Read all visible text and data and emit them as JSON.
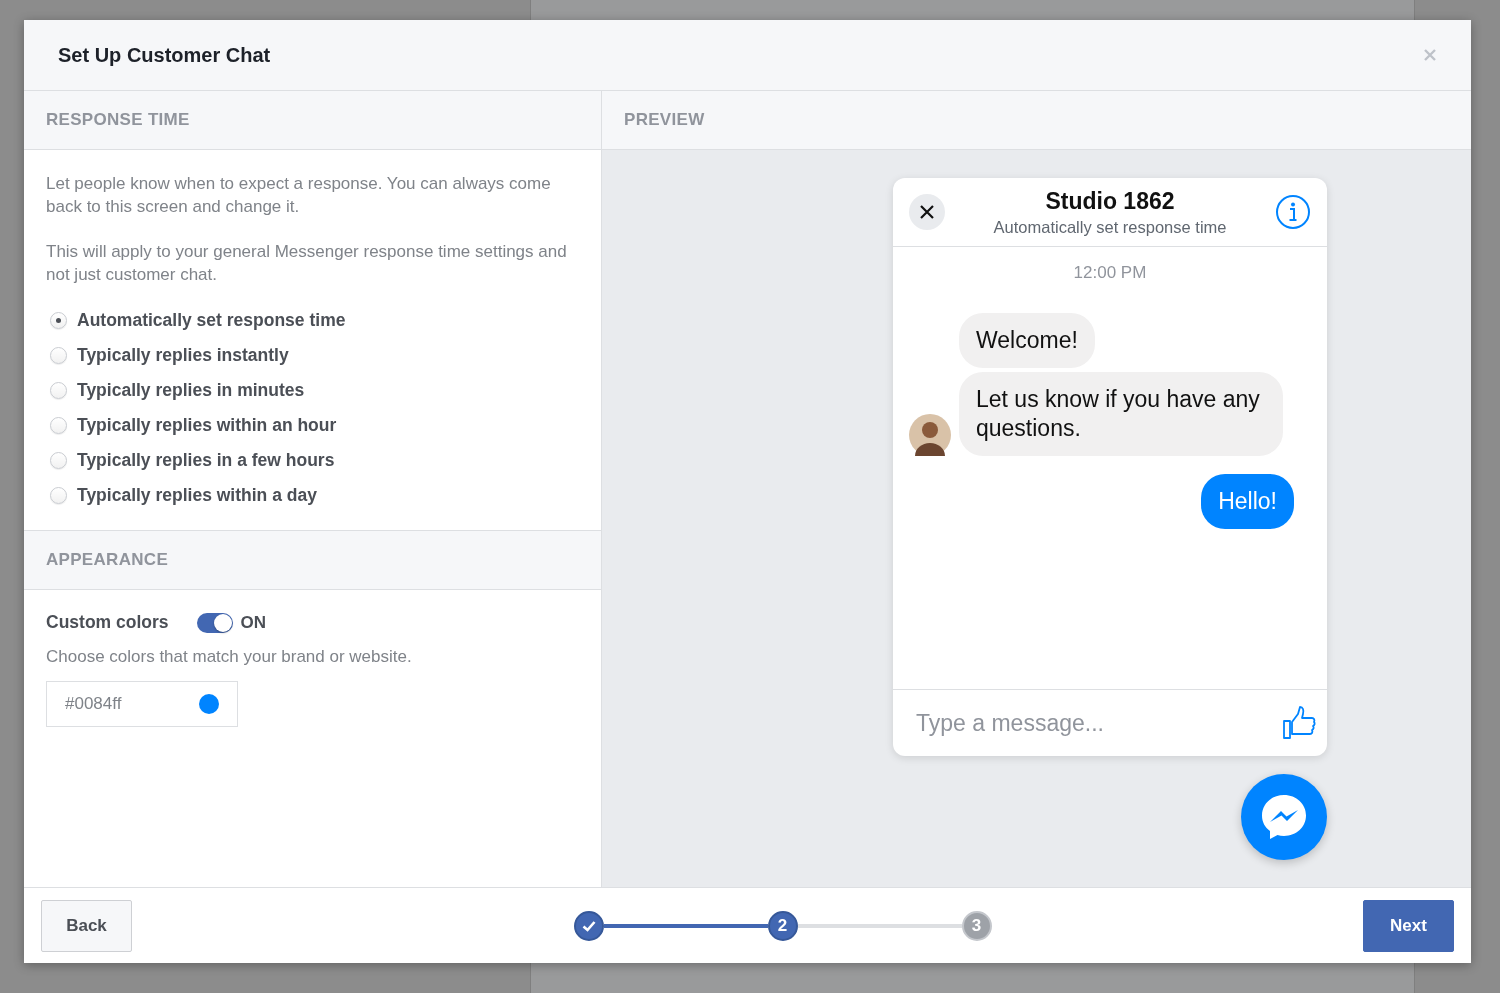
{
  "dialog": {
    "title": "Set Up Customer Chat"
  },
  "response_time": {
    "heading": "RESPONSE TIME",
    "paragraphs": [
      "Let people know when to expect a response. You can always come back to this screen and change it.",
      "This will apply to your general Messenger response time settings and not just customer chat."
    ],
    "options": [
      {
        "label": "Automatically set response time",
        "selected": true
      },
      {
        "label": "Typically replies instantly",
        "selected": false
      },
      {
        "label": "Typically replies in minutes",
        "selected": false
      },
      {
        "label": "Typically replies within an hour",
        "selected": false
      },
      {
        "label": "Typically replies in a few hours",
        "selected": false
      },
      {
        "label": "Typically replies within a day",
        "selected": false
      }
    ]
  },
  "appearance": {
    "heading": "APPEARANCE",
    "custom_colors": {
      "label": "Custom colors",
      "on": true,
      "state_label": "ON"
    },
    "hint": "Choose colors that match your brand or website.",
    "color_field": {
      "value": "#0084ff"
    }
  },
  "preview": {
    "heading": "PREVIEW",
    "chat": {
      "title": "Studio 1862",
      "subtitle": "Automatically set response time",
      "time": "12:00 PM",
      "messages": [
        {
          "kind": "received",
          "text": "Welcome!"
        },
        {
          "kind": "received",
          "text": "Let us know if you have any questions."
        },
        {
          "kind": "sent",
          "text": "Hello!"
        }
      ],
      "placeholder": "Type a message..."
    }
  },
  "footer": {
    "back": "Back",
    "steps": [
      {
        "kind": "done"
      },
      {
        "label": "2",
        "kind": "current"
      },
      {
        "label": "3",
        "kind": "upcoming"
      }
    ],
    "next": "Next"
  }
}
